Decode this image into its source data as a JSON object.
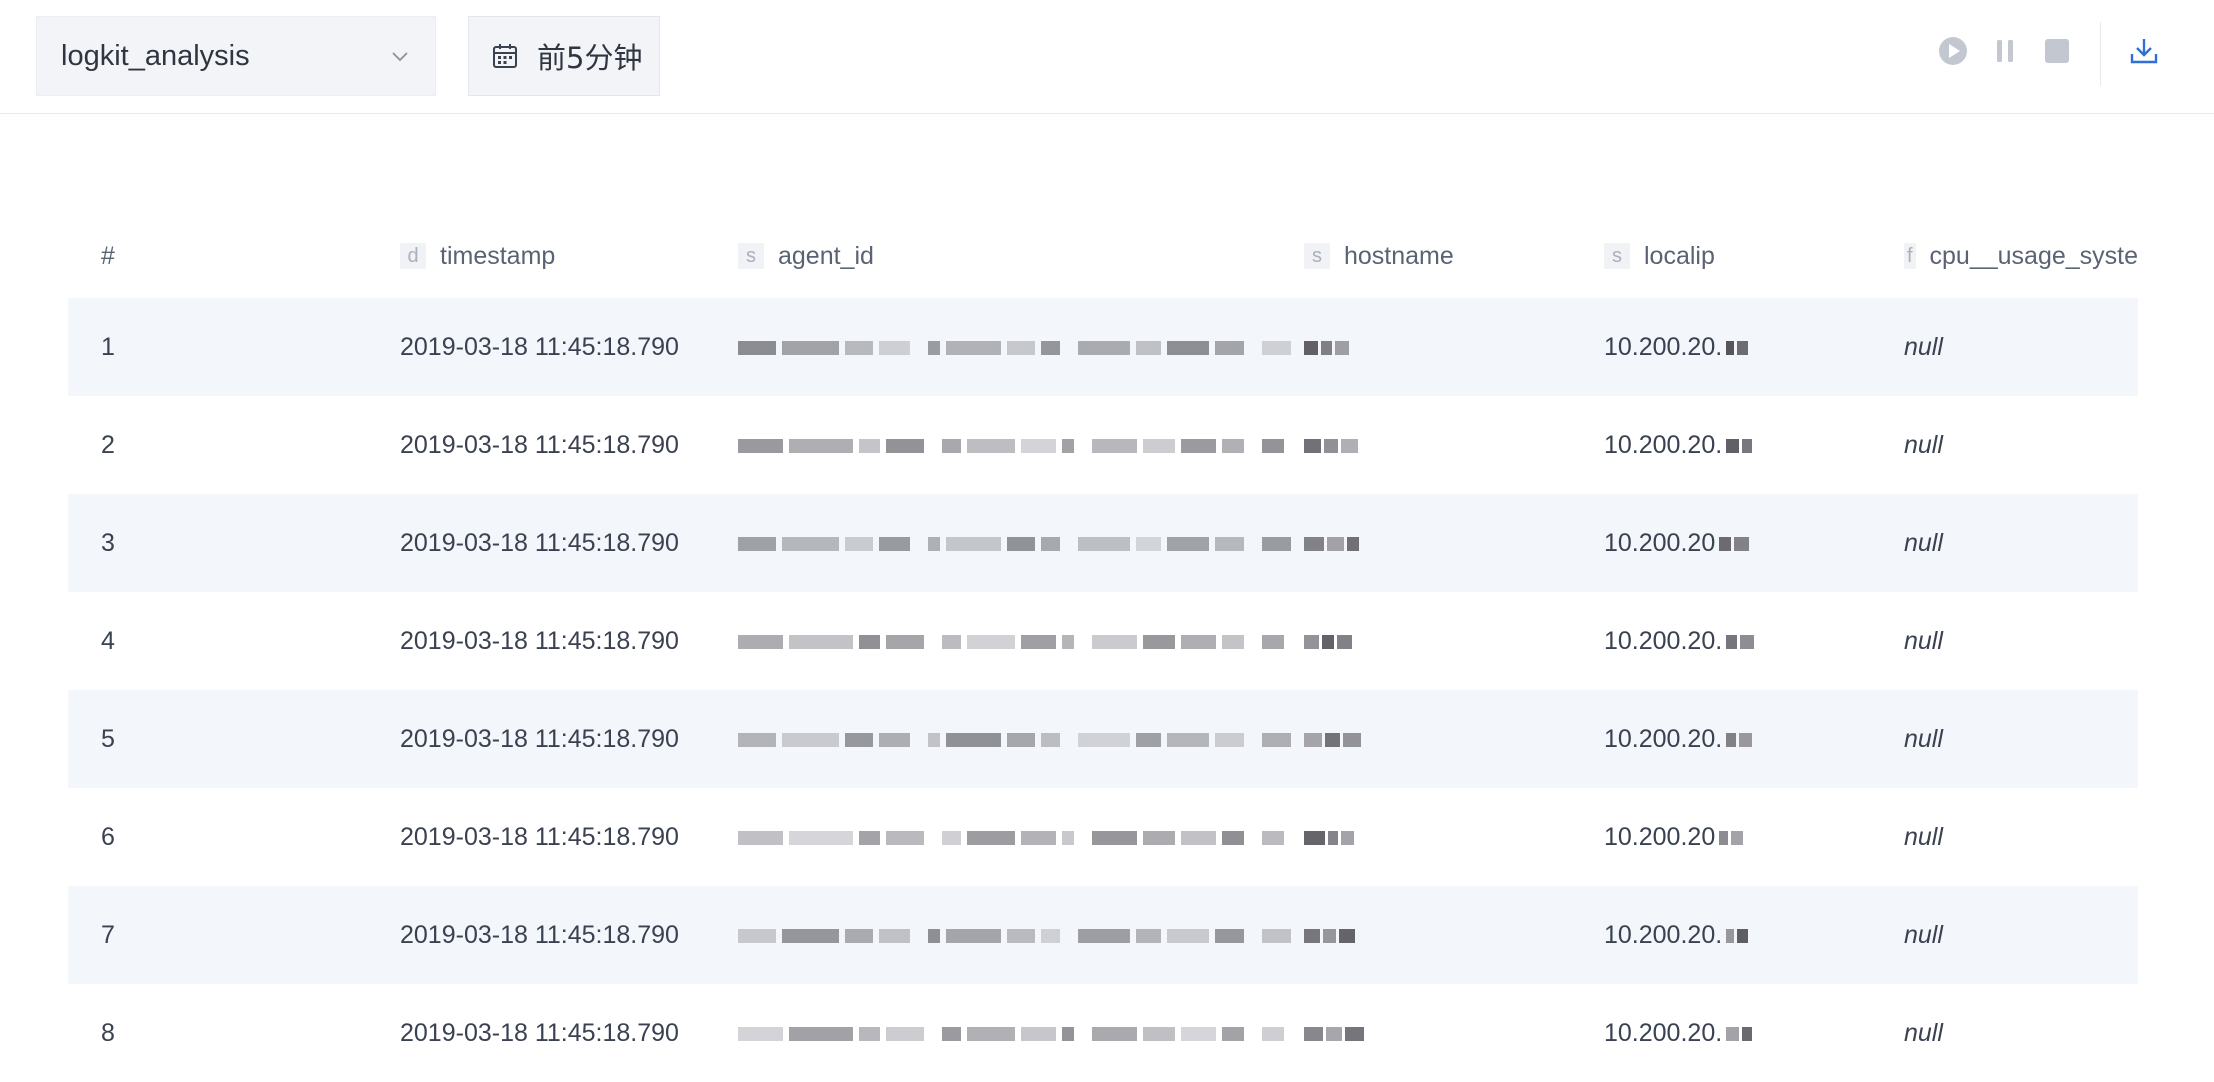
{
  "toolbar": {
    "repo_value": "logkit_analysis",
    "time_label": "前5分钟",
    "icons": {
      "dropdown": "chevron-down-icon",
      "calendar": "calendar-icon",
      "play": "play-icon",
      "pause": "pause-icon",
      "stop": "stop-icon",
      "download": "download-icon"
    },
    "accent_color": "#2f6fd6",
    "disabled_color": "#c3c8d0"
  },
  "table": {
    "columns": [
      {
        "type": "",
        "label": "#"
      },
      {
        "type": "d",
        "label": "timestamp"
      },
      {
        "type": "s",
        "label": "agent_id"
      },
      {
        "type": "s",
        "label": "hostname"
      },
      {
        "type": "s",
        "label": "localip"
      },
      {
        "type": "f",
        "label": "cpu__usage_syste"
      }
    ],
    "rows": [
      {
        "num": "1",
        "timestamp": "2019-03-18 11:45:18.790",
        "localip": "10.200.20.",
        "cpu": "null"
      },
      {
        "num": "2",
        "timestamp": "2019-03-18 11:45:18.790",
        "localip": "10.200.20.",
        "cpu": "null"
      },
      {
        "num": "3",
        "timestamp": "2019-03-18 11:45:18.790",
        "localip": "10.200.20",
        "cpu": "null"
      },
      {
        "num": "4",
        "timestamp": "2019-03-18 11:45:18.790",
        "localip": "10.200.20.",
        "cpu": "null"
      },
      {
        "num": "5",
        "timestamp": "2019-03-18 11:45:18.790",
        "localip": "10.200.20.",
        "cpu": "null"
      },
      {
        "num": "6",
        "timestamp": "2019-03-18 11:45:18.790",
        "localip": "10.200.20",
        "cpu": "null"
      },
      {
        "num": "7",
        "timestamp": "2019-03-18 11:45:18.790",
        "localip": "10.200.20.",
        "cpu": "null"
      },
      {
        "num": "8",
        "timestamp": "2019-03-18 11:45:18.790",
        "localip": "10.200.20.",
        "cpu": "null"
      }
    ]
  }
}
